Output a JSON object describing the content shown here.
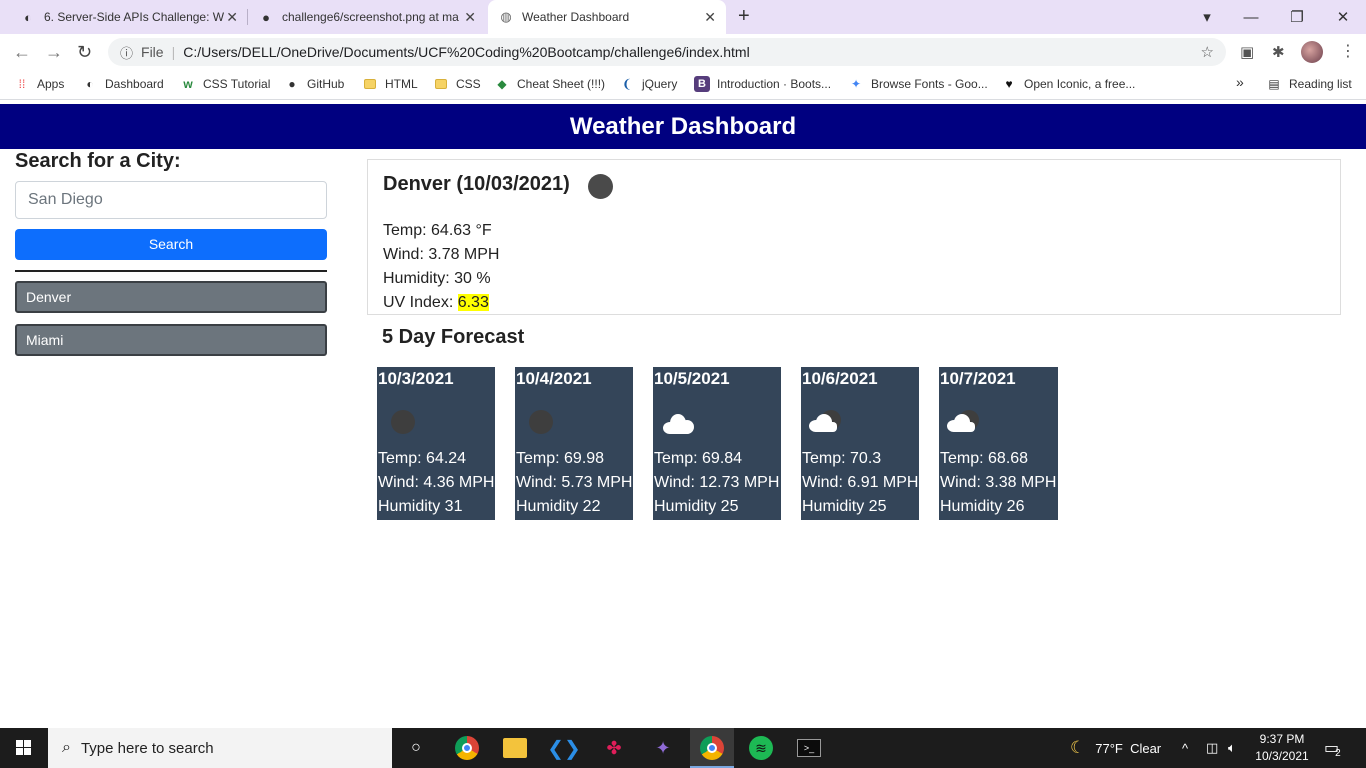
{
  "browser": {
    "tabs": [
      {
        "title": "6. Server-Side APIs Challenge: We",
        "icon": "cuda-icon"
      },
      {
        "title": "challenge6/screenshot.png at ma",
        "icon": "github-icon"
      },
      {
        "title": "Weather Dashboard",
        "icon": "globe-icon"
      }
    ],
    "address": {
      "scheme_label": "File",
      "url": "C:/Users/DELL/OneDrive/Documents/UCF%20Coding%20Bootcamp/challenge6/index.html"
    },
    "bookmarks": [
      {
        "label": "Apps",
        "icon": "apps-grid-icon"
      },
      {
        "label": "Dashboard",
        "icon": "cuda-icon"
      },
      {
        "label": "CSS Tutorial",
        "icon": "w3schools-icon"
      },
      {
        "label": "GitHub",
        "icon": "github-icon"
      },
      {
        "label": "HTML",
        "icon": "folder-icon"
      },
      {
        "label": "CSS",
        "icon": "folder-icon"
      },
      {
        "label": "Cheat Sheet (!!!)",
        "icon": "cheatsheet-icon"
      },
      {
        "label": "jQuery",
        "icon": "jquery-icon"
      },
      {
        "label": "Introduction · Boots...",
        "icon": "bootstrap-icon"
      },
      {
        "label": "Browse Fonts - Goo...",
        "icon": "google-fonts-icon"
      },
      {
        "label": "Open Iconic, a free...",
        "icon": "heart-icon"
      }
    ],
    "reading_list": "Reading list",
    "more_bookmarks": "»"
  },
  "app": {
    "header": "Weather Dashboard",
    "search": {
      "title": "Search for a City:",
      "placeholder": "San Diego",
      "button": "Search"
    },
    "history": [
      "Denver",
      "Miami"
    ],
    "current": {
      "title": "Denver (10/03/2021)",
      "icon": "moon-icon",
      "temp": "Temp: 64.63 °F",
      "wind": "Wind: 3.78 MPH",
      "humidity": "Humidity: 30 %",
      "uv_label": "UV Index: ",
      "uv_value": "6.33",
      "uv_color": "#ffff00"
    },
    "forecast_title": "5 Day Forecast",
    "forecast": [
      {
        "date": "10/3/2021",
        "icon": "night-clear-icon",
        "temp": "Temp: 64.24",
        "wind": "Wind: 4.36 MPH",
        "humidity": "Humidity 31"
      },
      {
        "date": "10/4/2021",
        "icon": "night-clear-icon",
        "temp": "Temp: 69.98",
        "wind": "Wind: 5.73 MPH",
        "humidity": "Humidity 22"
      },
      {
        "date": "10/5/2021",
        "icon": "cloud-icon",
        "temp": "Temp: 69.84",
        "wind": "Wind: 12.73 MPH",
        "humidity": "Humidity 25"
      },
      {
        "date": "10/6/2021",
        "icon": "partly-cloudy-night-icon",
        "temp": "Temp: 70.3",
        "wind": "Wind: 6.91 MPH",
        "humidity": "Humidity 25"
      },
      {
        "date": "10/7/2021",
        "icon": "partly-cloudy-night-icon",
        "temp": "Temp: 68.68",
        "wind": "Wind: 3.38 MPH",
        "humidity": "Humidity 26"
      }
    ],
    "colors": {
      "header": "#000080",
      "search_button": "#0d6efd",
      "history_button": "#6c757d",
      "card": "#344559"
    }
  },
  "taskbar": {
    "search_placeholder": "Type here to search",
    "weather": "77°F  Clear",
    "time": "9:37 PM",
    "date": "10/3/2021",
    "notifications": "2"
  }
}
